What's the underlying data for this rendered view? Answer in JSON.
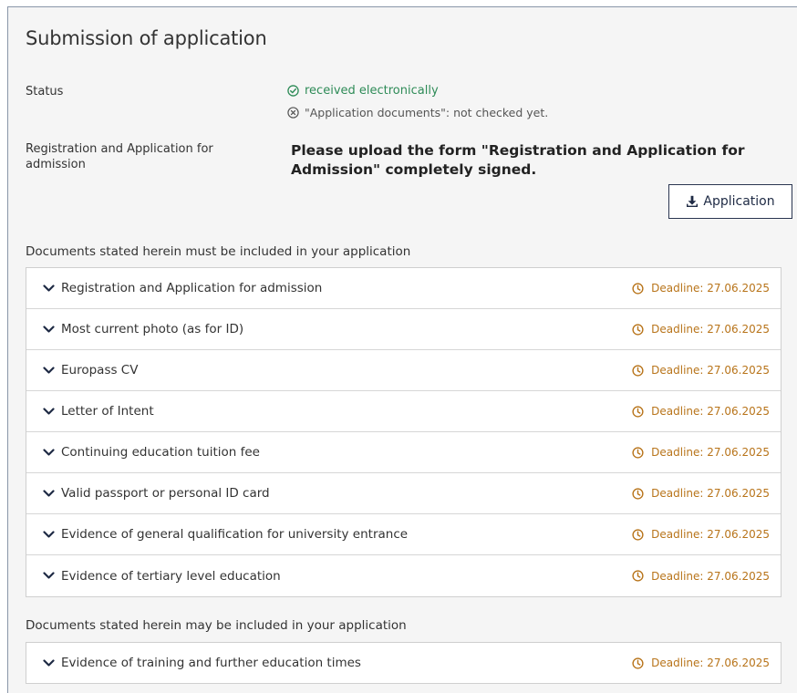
{
  "section": {
    "title": "Submission of application"
  },
  "status": {
    "label": "Status",
    "received": "received electronically",
    "documents_check": "\"Application documents\": not checked yet."
  },
  "registration": {
    "label": "Registration and Application for admission",
    "instruction": "Please upload the form \"Registration and Application for Admission\" completely signed.",
    "button_label": "Application"
  },
  "required_docs": {
    "heading": "Documents stated herein must be included in your application",
    "items": [
      {
        "title": "Registration and Application for admission",
        "deadline": "Deadline: 27.06.2025"
      },
      {
        "title": "Most current photo (as for ID)",
        "deadline": "Deadline: 27.06.2025"
      },
      {
        "title": "Europass CV",
        "deadline": "Deadline: 27.06.2025"
      },
      {
        "title": "Letter of Intent",
        "deadline": "Deadline: 27.06.2025"
      },
      {
        "title": "Continuing education tuition fee",
        "deadline": "Deadline: 27.06.2025"
      },
      {
        "title": "Valid passport or personal ID card",
        "deadline": "Deadline: 27.06.2025"
      },
      {
        "title": "Evidence of general qualification for university entrance",
        "deadline": "Deadline: 27.06.2025"
      },
      {
        "title": "Evidence of tertiary level education",
        "deadline": "Deadline: 27.06.2025"
      }
    ]
  },
  "optional_docs": {
    "heading": "Documents stated herein may be included in your application",
    "items": [
      {
        "title": "Evidence of training and further education times",
        "deadline": "Deadline: 27.06.2025"
      }
    ]
  },
  "colors": {
    "success": "#2e8b57",
    "deadline": "#b8741a",
    "panel_bg": "#f5f5f5"
  },
  "icons": {
    "received": "check-circle-icon",
    "not_checked": "x-circle-icon",
    "download": "download-icon",
    "expand": "chevron-down-icon",
    "deadline": "clock-icon"
  }
}
